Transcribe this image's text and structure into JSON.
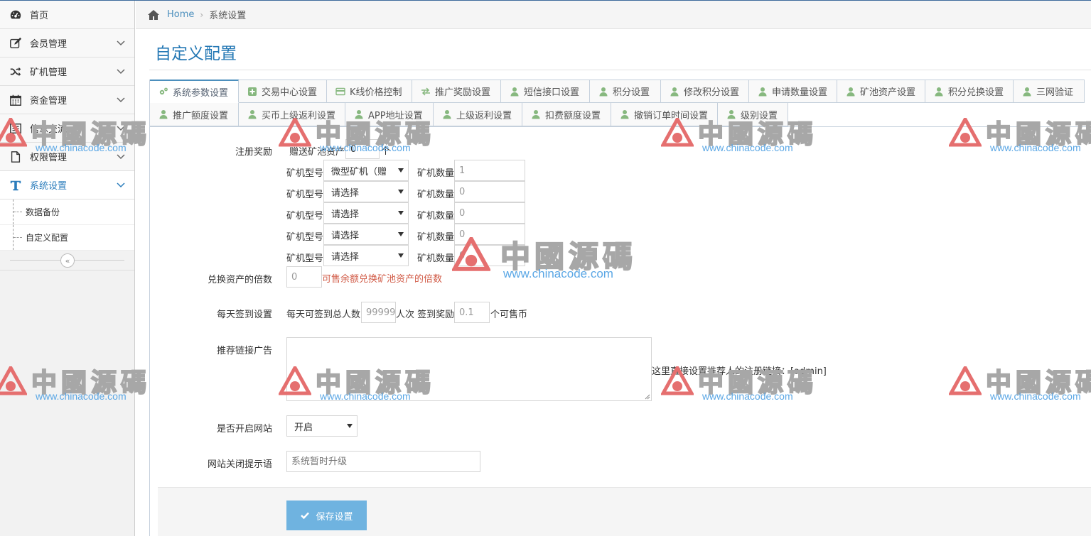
{
  "sidebar": {
    "items": [
      {
        "label": "首页",
        "icon": "dashboard-icon",
        "has_arrow": false
      },
      {
        "label": "会员管理",
        "icon": "edit-icon",
        "has_arrow": true
      },
      {
        "label": "矿机管理",
        "icon": "shuffle-icon",
        "has_arrow": true
      },
      {
        "label": "资金管理",
        "icon": "calendar-icon",
        "has_arrow": true
      },
      {
        "label": "信息交流",
        "icon": "list-icon",
        "has_arrow": true
      },
      {
        "label": "权限管理",
        "icon": "file-icon",
        "has_arrow": true
      },
      {
        "label": "系统设置",
        "icon": "text-icon",
        "has_arrow": true,
        "active": true
      }
    ],
    "sub_items": [
      {
        "label": "数据备份"
      },
      {
        "label": "自定义配置"
      }
    ],
    "collapse_glyph": "«"
  },
  "breadcrumb": {
    "home": "Home",
    "current": "系统设置"
  },
  "page_title": "自定义配置",
  "tabs": {
    "row1": [
      {
        "label": "系统参数设置",
        "icon": "cogs-icon",
        "active": true
      },
      {
        "label": "交易中心设置",
        "icon": "plus-square-icon"
      },
      {
        "label": "K线价格控制",
        "icon": "credit-card-icon"
      },
      {
        "label": "推广奖励设置",
        "icon": "exchange-icon"
      },
      {
        "label": "短信接口设置",
        "icon": "user-icon"
      },
      {
        "label": "积分设置",
        "icon": "user-icon"
      },
      {
        "label": "修改积分设置",
        "icon": "user-icon"
      },
      {
        "label": "申请数量设置",
        "icon": "user-icon"
      },
      {
        "label": "矿池资产设置",
        "icon": "user-icon"
      },
      {
        "label": "积分兑换设置",
        "icon": "user-icon"
      },
      {
        "label": "三网验证",
        "icon": "user-icon"
      }
    ],
    "row2": [
      {
        "label": "推广额度设置",
        "icon": "user-icon"
      },
      {
        "label": "买币上级返利设置",
        "icon": "user-icon"
      },
      {
        "label": "APP地址设置",
        "icon": "user-icon"
      },
      {
        "label": "上级返利设置",
        "icon": "user-icon"
      },
      {
        "label": "扣费额度设置",
        "icon": "user-icon"
      },
      {
        "label": "撤销订单时间设置",
        "icon": "user-icon"
      },
      {
        "label": "级别设置",
        "icon": "user-icon"
      }
    ]
  },
  "form": {
    "register_reward": {
      "label": "注册奖励",
      "gift_text": "赠送矿池资产",
      "gift_value": "0",
      "gift_unit": "个",
      "rows": [
        {
          "type_label": "矿机型号",
          "type_value": "微型矿机（赠",
          "qty_label": "矿机数量",
          "qty_value": "1"
        },
        {
          "type_label": "矿机型号",
          "type_value": "请选择",
          "qty_label": "矿机数量",
          "qty_value": "0"
        },
        {
          "type_label": "矿机型号",
          "type_value": "请选择",
          "qty_label": "矿机数量",
          "qty_value": "0"
        },
        {
          "type_label": "矿机型号",
          "type_value": "请选择",
          "qty_label": "矿机数量",
          "qty_value": "0"
        },
        {
          "type_label": "矿机型号",
          "type_value": "请选择",
          "qty_label": "矿机数量",
          "qty_value": "0"
        }
      ]
    },
    "exchange_multiple": {
      "label": "兑换资产的倍数",
      "value": "0",
      "hint": "可售余额兑换矿池资产的倍数"
    },
    "daily_checkin": {
      "label": "每天签到设置",
      "prefix": "每天可签到总人数",
      "total_value": "99999",
      "mid": "人次 签到奖励",
      "reward_value": "0.1",
      "suffix": "个可售币"
    },
    "referral_ad": {
      "label": "推荐链接广告",
      "hint": "这里直接设置推荐人的注册链接：[admin]"
    },
    "site_open": {
      "label": "是否开启网站",
      "value": "开启"
    },
    "close_notice": {
      "label": "网站关闭提示语",
      "placeholder": "系统暂时升级"
    },
    "save_label": "保存设置"
  },
  "watermark": {
    "cn": "中國源碼",
    "url": "www.chinacode.com"
  },
  "colors": {
    "accent": "#2679b5",
    "link": "#4c8fbd",
    "tab_icon_green": "#87b87f",
    "hint_red": "#d15b47",
    "save_button": "#6fb3e0"
  }
}
